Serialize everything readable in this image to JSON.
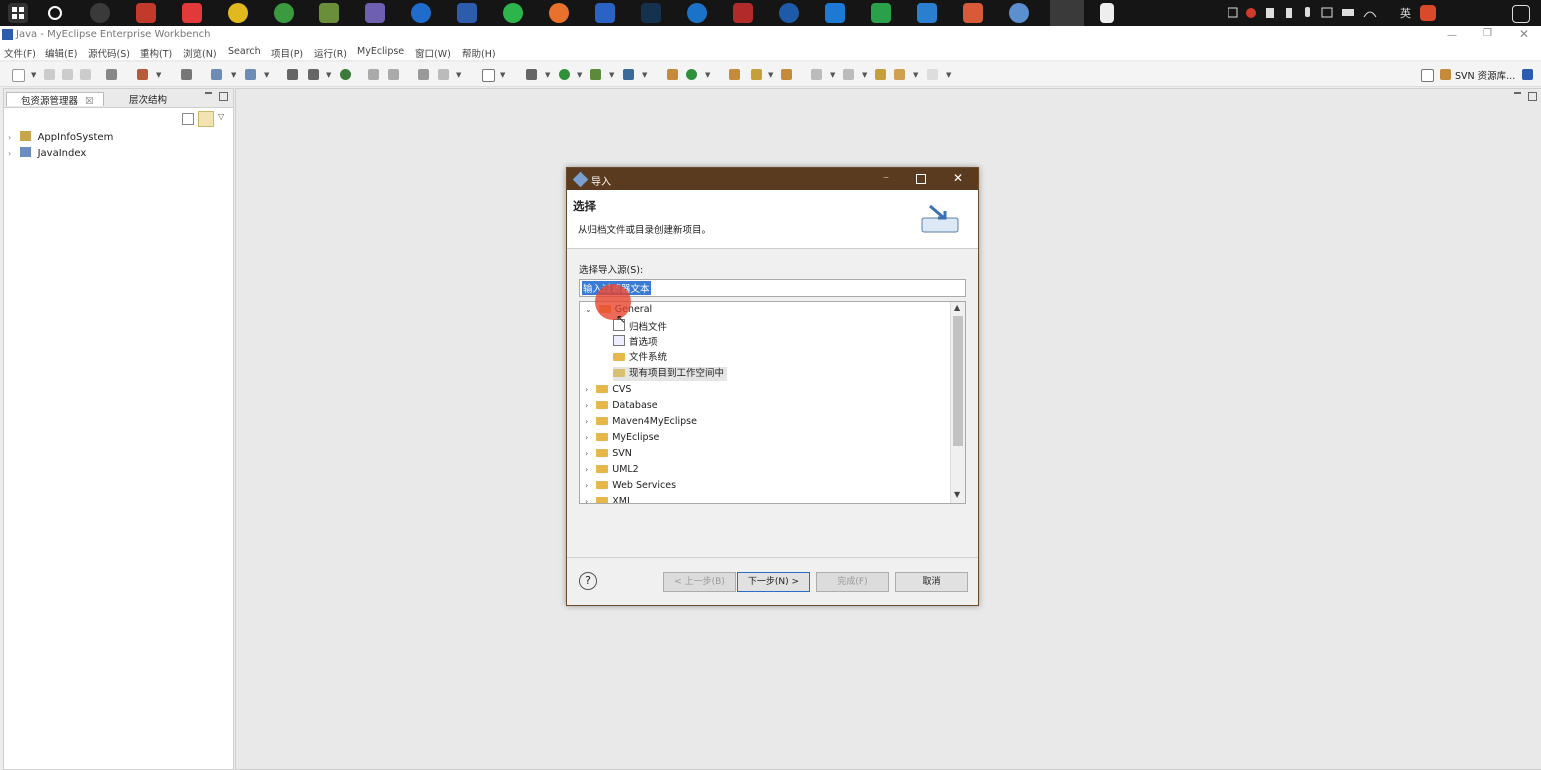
{
  "window": {
    "title": "Java  -  MyEclipse Enterprise Workbench"
  },
  "tray": {
    "ime": "英"
  },
  "menu": [
    "文件(F)",
    "编辑(E)",
    "源代码(S)",
    "重构(T)",
    "浏览(N)",
    "Search",
    "项目(P)",
    "运行(R)",
    "MyEclipse",
    "窗口(W)",
    "帮助(H)"
  ],
  "toolbar": {
    "svn_perspective": "SVN 资源库..."
  },
  "left_panel": {
    "tabs": [
      "包资源管理器",
      "层次结构"
    ],
    "projects": [
      "AppInfoSystem",
      "JavaIndex"
    ]
  },
  "dialog": {
    "title": "导入",
    "header_title": "选择",
    "header_desc": "从归档文件或目录创建新项目。",
    "source_label": "选择导入源(S):",
    "filter_value": "输入过滤器文本",
    "tree": {
      "general": "General",
      "general_children": [
        "归档文件",
        "首选项",
        "文件系统",
        "现有项目到工作空间中"
      ],
      "categories": [
        "CVS",
        "Database",
        "Maven4MyEclipse",
        "MyEclipse",
        "SVN",
        "UML2",
        "Web Services",
        "XML"
      ]
    },
    "buttons": {
      "back": "< 上一步(B)",
      "next": "下一步(N) >",
      "finish": "完成(F)",
      "cancel": "取消"
    },
    "help": "?"
  },
  "colors": {
    "dialog_title_bg": "#5b3b1f",
    "selection": "#3a7bd5",
    "highlight_pointer": "#e8402a"
  }
}
